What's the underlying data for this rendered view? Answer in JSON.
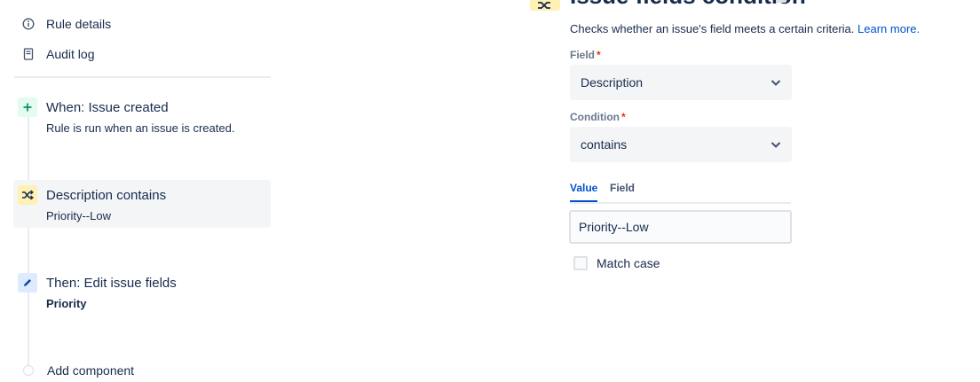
{
  "nav": {
    "rule_details": "Rule details",
    "audit_log": "Audit log"
  },
  "rule": {
    "trigger": {
      "title": "When: Issue created",
      "subtitle": "Rule is run when an issue is created.",
      "icon": "plus-icon",
      "color": "#e3fcef",
      "icon_color": "#00875a"
    },
    "condition": {
      "title": "Description contains",
      "subtitle": "Priority--Low",
      "icon": "shuffle-icon",
      "color": "#fff0b3",
      "icon_color": "#172b4d"
    },
    "action": {
      "title": "Then: Edit issue fields",
      "subtitle": "Priority",
      "icon": "pencil-icon",
      "color": "#deebff",
      "icon_color": "#0747a6"
    },
    "add_component": "Add component"
  },
  "panel": {
    "title": "Issue fields condition",
    "description": "Checks whether an issue's field meets a certain criteria.",
    "learn_more": "Learn more.",
    "field_label": "Field",
    "field_value": "Description",
    "condition_label": "Condition",
    "condition_value": "contains",
    "required_marker": "*",
    "tabs": {
      "value": "Value",
      "field": "Field"
    },
    "value_input": "Priority--Low",
    "match_case": "Match case"
  },
  "colors": {
    "accent": "#0052cc",
    "required": "#de350b",
    "selected_bg": "#f4f5f7"
  }
}
